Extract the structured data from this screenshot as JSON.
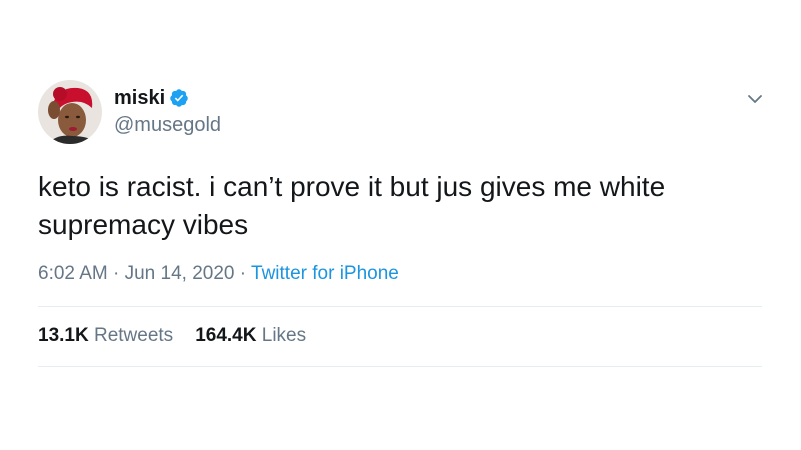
{
  "author": {
    "display_name": "miski",
    "handle": "@musegold",
    "verified": true,
    "avatar_icon": "profile-avatar"
  },
  "tweet": {
    "text": "keto is racist. i can’t prove it but jus gives me white supremacy vibes"
  },
  "meta": {
    "time": "6:02 AM",
    "separator1": " · ",
    "date": "Jun 14, 2020",
    "separator2": " · ",
    "source": "Twitter for iPhone"
  },
  "stats": {
    "retweets_count": "13.1K",
    "retweets_label": "Retweets",
    "likes_count": "164.4K",
    "likes_label": "Likes"
  },
  "colors": {
    "text_primary": "#14171a",
    "text_secondary": "#657786",
    "link": "#1b95e0",
    "verified_badge": "#1da1f2",
    "avatar_headwrap": "#c8102e"
  },
  "icons": {
    "verified": "verified-badge-icon",
    "menu": "chevron-down-icon"
  }
}
